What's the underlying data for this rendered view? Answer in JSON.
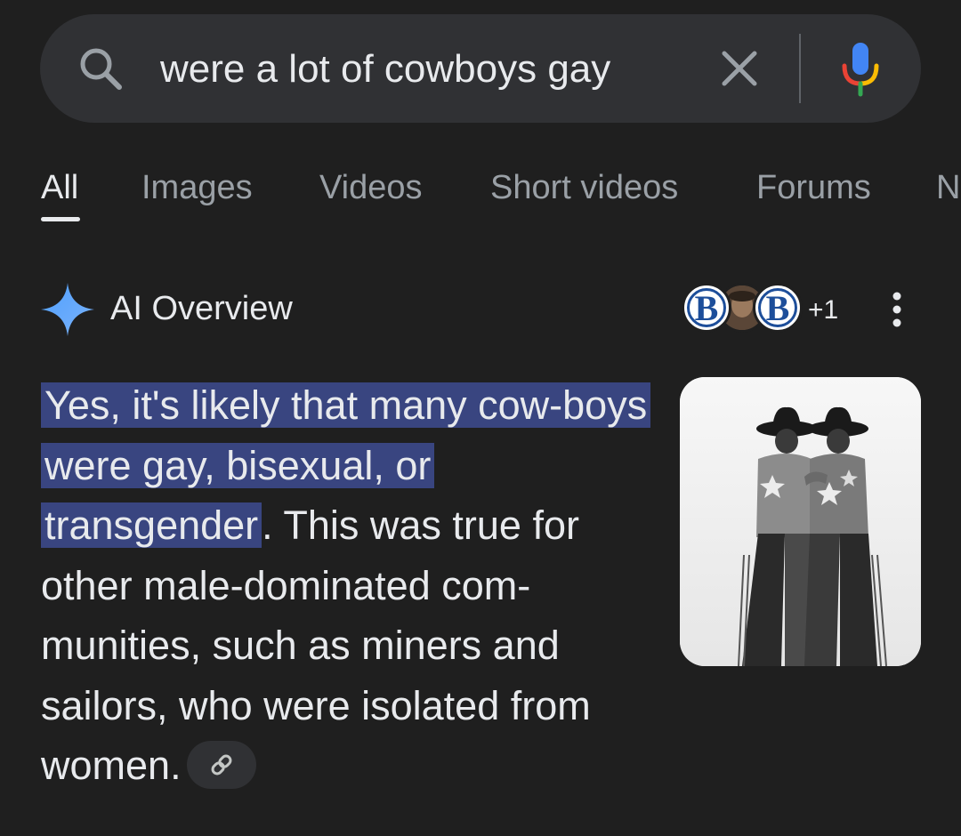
{
  "search": {
    "query": "were a lot of cowboys gay"
  },
  "tabs": [
    {
      "label": "All",
      "active": true
    },
    {
      "label": "Images"
    },
    {
      "label": "Videos"
    },
    {
      "label": "Short videos"
    },
    {
      "label": "Forums"
    },
    {
      "label": "N"
    }
  ],
  "ai_overview": {
    "title": "AI Overview",
    "sources_more": "+1",
    "source_avatar_letters": [
      "B",
      "B"
    ],
    "answer_highlight": "Yes, it's likely that many cow-boys were gay, bisexual, or transgender",
    "answer_rest": ". This was true for other male-dominated com-munities, such as miners and sailors, who were isolated from women."
  },
  "colors": {
    "background": "#1f1f1f",
    "search_bar": "#303134",
    "highlight": "#394580",
    "sparkle": "#5b9bf6"
  },
  "icons": [
    "search-icon",
    "clear-icon",
    "mic-icon",
    "sparkle-icon",
    "kebab-icon",
    "link-icon"
  ]
}
